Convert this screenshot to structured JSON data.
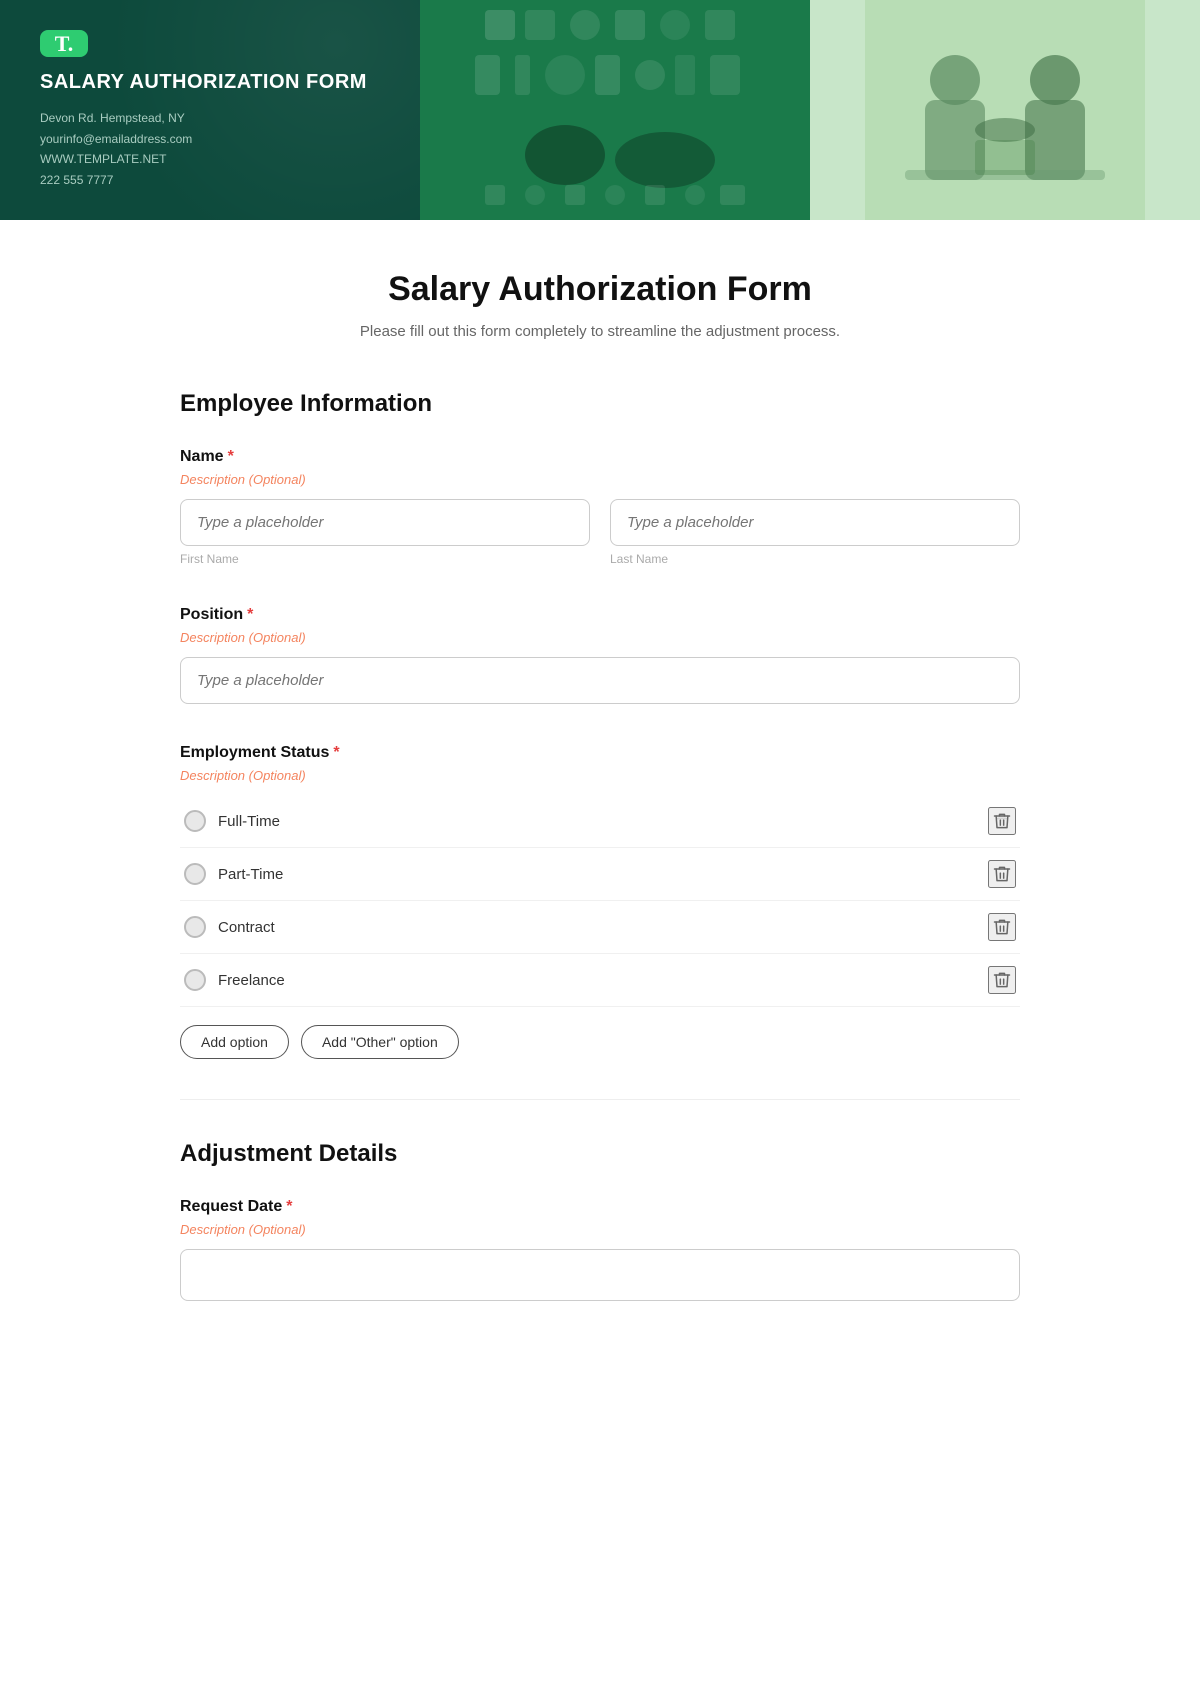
{
  "header": {
    "logo_letter": "T.",
    "form_title": "SALARY AUTHORIZATION FORM",
    "address_line1": "Devon Rd. Hempstead, NY",
    "email": "yourinfo@emailaddress.com",
    "website": "WWW.TEMPLATE.NET",
    "phone": "222 555 7777"
  },
  "main": {
    "title": "Salary Authorization Form",
    "subtitle": "Please fill out this form completely to streamline the adjustment process.",
    "sections": [
      {
        "id": "employee-info",
        "heading": "Employee Information"
      },
      {
        "id": "adjustment-details",
        "heading": "Adjustment Details"
      }
    ],
    "fields": {
      "name": {
        "label": "Name",
        "required": true,
        "description": "Description (Optional)",
        "first_name_placeholder": "Type a placeholder",
        "last_name_placeholder": "Type a placeholder",
        "first_name_sublabel": "First Name",
        "last_name_sublabel": "Last Name"
      },
      "position": {
        "label": "Position",
        "required": true,
        "description": "Description (Optional)",
        "placeholder": "Type a placeholder"
      },
      "employment_status": {
        "label": "Employment Status",
        "required": true,
        "description": "Description (Optional)",
        "options": [
          {
            "id": "full-time",
            "label": "Full-Time"
          },
          {
            "id": "part-time",
            "label": "Part-Time"
          },
          {
            "id": "contract",
            "label": "Contract"
          },
          {
            "id": "freelance",
            "label": "Freelance"
          }
        ],
        "add_option_label": "Add option",
        "add_other_label": "Add \"Other\" option"
      },
      "request_date": {
        "label": "Request Date",
        "required": true,
        "description": "Description (Optional)"
      }
    }
  }
}
